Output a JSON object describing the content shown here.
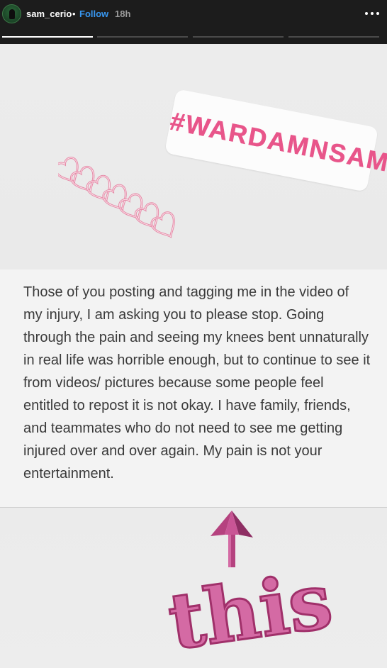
{
  "header": {
    "username": "sam_cerio",
    "separator": "•",
    "follow_label": "Follow",
    "time_ago": "18h",
    "more_icon": "more-horizontal-icon"
  },
  "story_progress": {
    "segments": 4,
    "current_segment_fill": 1.0
  },
  "stickers": {
    "hashtag": "#WARDAMNSAM",
    "hashtag_color": "#e8558a",
    "hearts_icon": "stacked-hearts-icon",
    "arrow_icon": "up-arrow-icon",
    "this_text": "this"
  },
  "body_text": "Those of you posting and tagging me in the video of my injury, I am asking you to please stop. Going through the pain and seeing my knees bent unnaturally in real life was horrible enough, but to continue to see it from videos/ pictures because some people feel entitled to repost it is not okay.  I have family, friends, and teammates who do not need to see me getting injured over and over again. My pain is not your entertainment."
}
